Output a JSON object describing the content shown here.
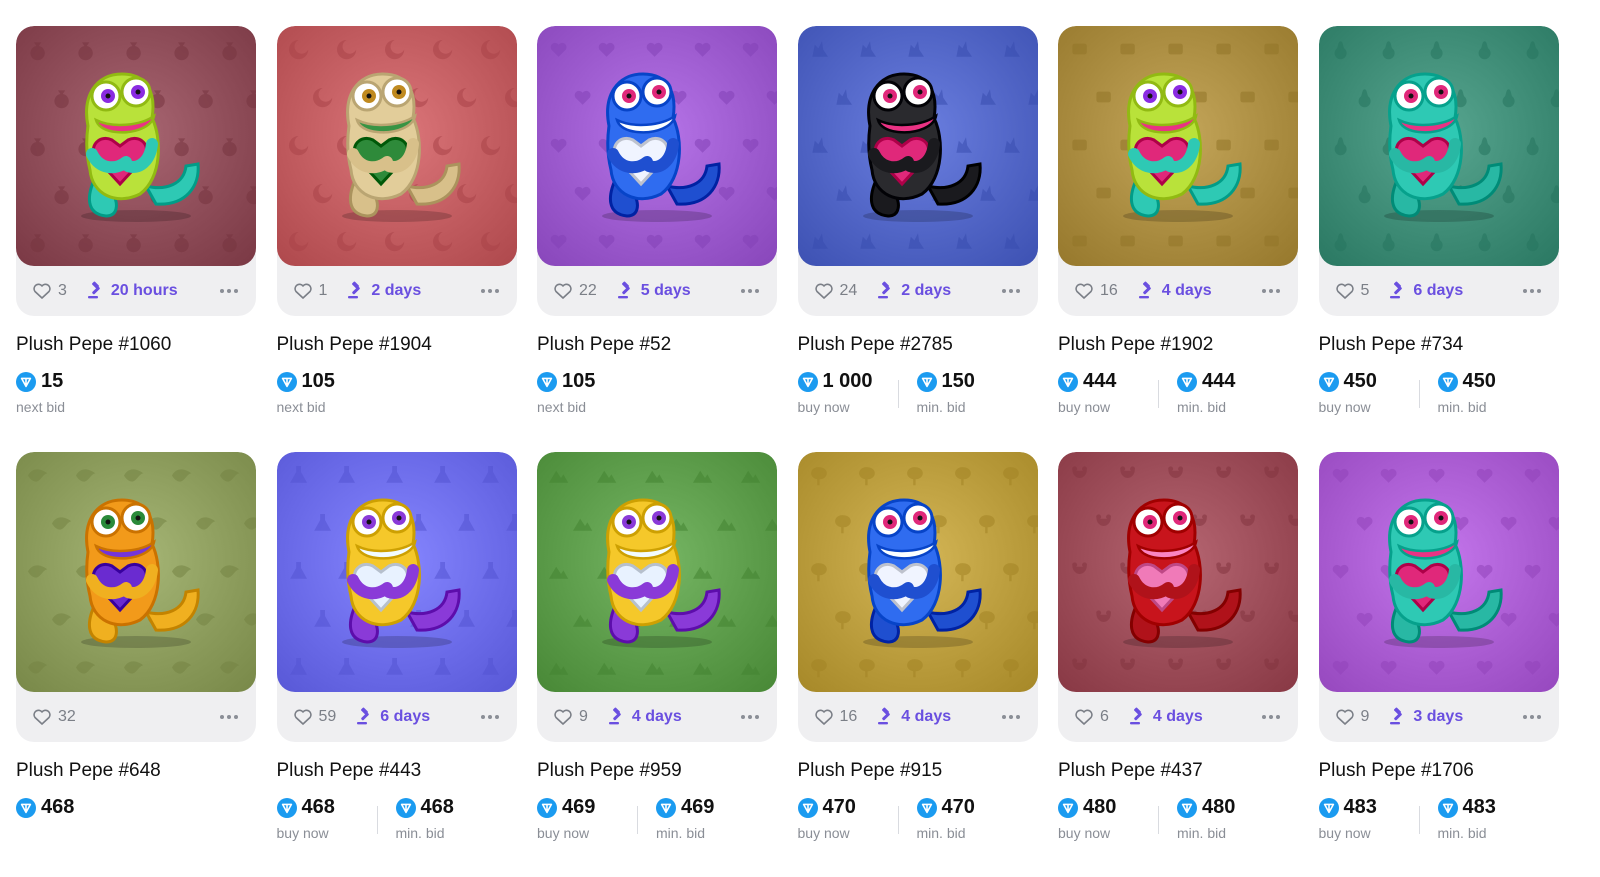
{
  "items": [
    {
      "title": "Plush Pepe #1060",
      "likes": "3",
      "timer": "20 hours",
      "bg": "#8c4a56",
      "pattern": "money-bag",
      "body": "#b9e23a",
      "heart": "#e0287a",
      "limb": "#2ec9b4",
      "eye": "#8a2be2",
      "prices": [
        {
          "value": "15",
          "label": "next bid"
        }
      ]
    },
    {
      "title": "Plush Pepe #1904",
      "likes": "1",
      "timer": "2 days",
      "bg": "#c05a5e",
      "pattern": "moon",
      "body": "#e2cd9a",
      "heart": "#2e8a3a",
      "limb": "#d8c08a",
      "eye": "#c08a20",
      "prices": [
        {
          "value": "105",
          "label": "next bid"
        }
      ]
    },
    {
      "title": "Plush Pepe #52",
      "likes": "22",
      "timer": "5 days",
      "bg": "#9a58cc",
      "pattern": "heart",
      "body": "#2f6cf0",
      "heart": "#f0f4ff",
      "limb": "#1f4fd0",
      "eye": "#e0287a",
      "prices": [
        {
          "value": "105",
          "label": "next bid"
        }
      ]
    },
    {
      "title": "Plush Pepe #2785",
      "likes": "24",
      "timer": "2 days",
      "bg": "#4f63c4",
      "pattern": "wolf",
      "body": "#2a2a2e",
      "heart": "#e0287a",
      "limb": "#1a1a1e",
      "eye": "#e0287a",
      "prices": [
        {
          "value": "1 000",
          "label": "buy now"
        },
        {
          "value": "150",
          "label": "min. bid"
        }
      ]
    },
    {
      "title": "Plush Pepe #1902",
      "likes": "16",
      "timer": "4 days",
      "bg": "#a88a3e",
      "pattern": "ticket",
      "body": "#b9e23a",
      "heart": "#e0287a",
      "limb": "#2ec9b4",
      "eye": "#8a2be2",
      "prices": [
        {
          "value": "444",
          "label": "buy now"
        },
        {
          "value": "444",
          "label": "min. bid"
        }
      ]
    },
    {
      "title": "Plush Pepe #734",
      "likes": "5",
      "timer": "6 days",
      "bg": "#3c8a74",
      "pattern": "pear",
      "body": "#2ec9b4",
      "heart": "#e0287a",
      "limb": "#28b8a4",
      "eye": "#e0287a",
      "prices": [
        {
          "value": "450",
          "label": "buy now"
        },
        {
          "value": "450",
          "label": "min. bid"
        }
      ]
    },
    {
      "title": "Plush Pepe #648",
      "likes": "32",
      "timer": "",
      "bg": "#8a9a5a",
      "pattern": "lion",
      "body": "#f29a1a",
      "heart": "#6a2bd0",
      "limb": "#f0b020",
      "eye": "#2a8a3a",
      "prices": [
        {
          "value": "468",
          "label": ""
        }
      ]
    },
    {
      "title": "Plush Pepe #443",
      "likes": "59",
      "timer": "6 days",
      "bg": "#6a6ae8",
      "pattern": "flask",
      "body": "#f5c82a",
      "heart": "#e8f2ff",
      "limb": "#8a3ad8",
      "eye": "#8a3ad8",
      "prices": [
        {
          "value": "468",
          "label": "buy now"
        },
        {
          "value": "468",
          "label": "min. bid"
        }
      ]
    },
    {
      "title": "Plush Pepe #959",
      "likes": "9",
      "timer": "4 days",
      "bg": "#5a9a48",
      "pattern": "mountain",
      "body": "#f5c82a",
      "heart": "#e8f2ff",
      "limb": "#8a3ad8",
      "eye": "#8a3ad8",
      "prices": [
        {
          "value": "469",
          "label": "buy now"
        },
        {
          "value": "469",
          "label": "min. bid"
        }
      ]
    },
    {
      "title": "Plush Pepe #915",
      "likes": "16",
      "timer": "4 days",
      "bg": "#b89a3a",
      "pattern": "tree",
      "body": "#2f6cf0",
      "heart": "#f0f4ff",
      "limb": "#1f4fd0",
      "eye": "#e0287a",
      "prices": [
        {
          "value": "470",
          "label": "buy now"
        },
        {
          "value": "470",
          "label": "min. bid"
        }
      ]
    },
    {
      "title": "Plush Pepe #437",
      "likes": "6",
      "timer": "4 days",
      "bg": "#9a4a56",
      "pattern": "bear",
      "body": "#c8141c",
      "heart": "#f07ab8",
      "limb": "#b0121a",
      "eye": "#e0287a",
      "prices": [
        {
          "value": "480",
          "label": "buy now"
        },
        {
          "value": "480",
          "label": "min. bid"
        }
      ]
    },
    {
      "title": "Plush Pepe #1706",
      "likes": "9",
      "timer": "3 days",
      "bg": "#a85ad0",
      "pattern": "heart",
      "body": "#2ec9b4",
      "heart": "#e0287a",
      "limb": "#28b8a4",
      "eye": "#e0287a",
      "prices": [
        {
          "value": "483",
          "label": "buy now"
        },
        {
          "value": "483",
          "label": "min. bid"
        }
      ]
    }
  ]
}
